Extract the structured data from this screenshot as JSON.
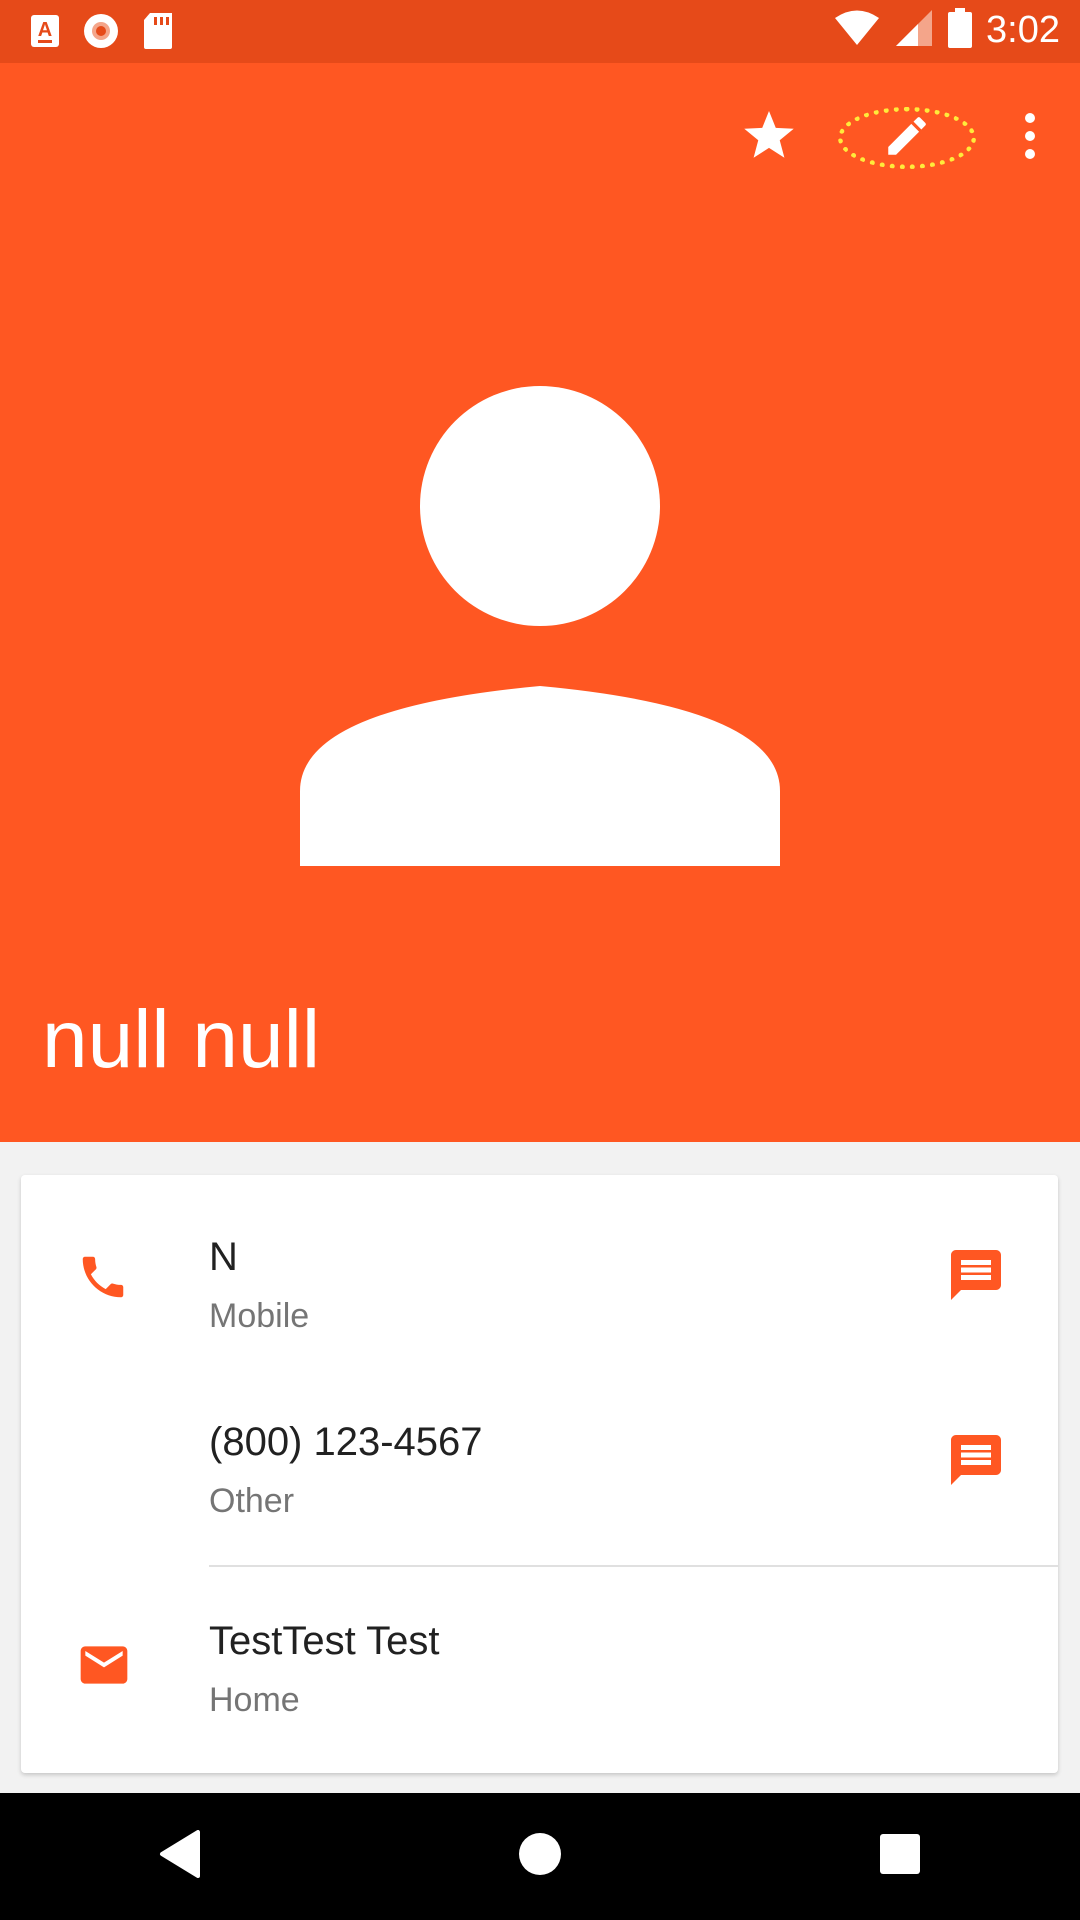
{
  "status_bar": {
    "time": "3:02",
    "left_icons": [
      "font-a-icon",
      "record-icon",
      "sd-card-icon"
    ],
    "right_icons": [
      "wifi-icon",
      "signal-icon",
      "battery-icon"
    ]
  },
  "header": {
    "contact_name": "null null",
    "actions": [
      "star-icon",
      "edit-icon",
      "more-vert-icon"
    ],
    "accent_color": "#ff5722",
    "status_color": "#e64a19",
    "highlight_color": "#ffeb3b"
  },
  "details": {
    "phones": [
      {
        "number": "N",
        "type": "Mobile"
      },
      {
        "number": "(800) 123-4567",
        "type": "Other"
      }
    ],
    "emails": [
      {
        "address": "TestTest Test",
        "type": "Home"
      }
    ]
  },
  "nav_bar": {
    "buttons": [
      "back-icon",
      "home-icon",
      "recents-icon"
    ]
  }
}
